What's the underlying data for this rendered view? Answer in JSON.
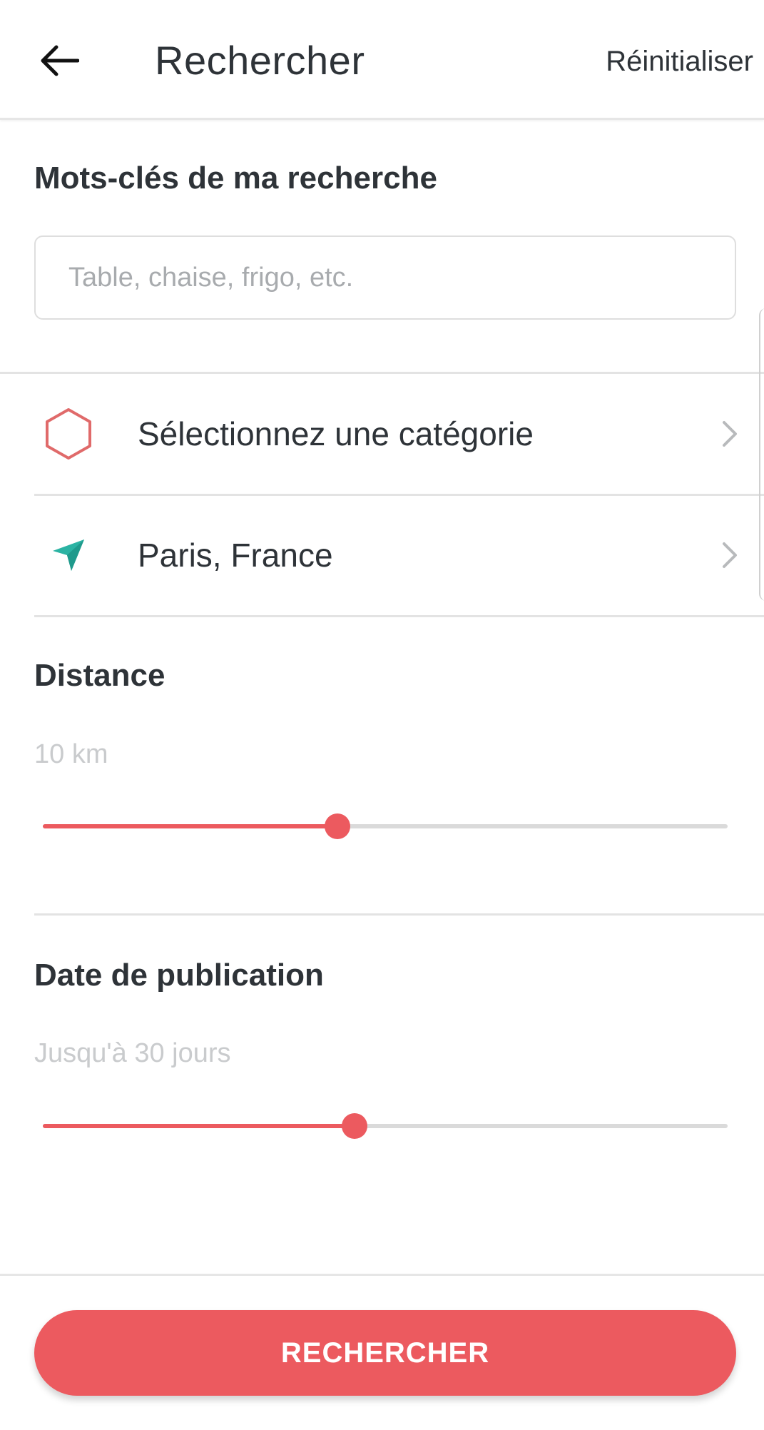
{
  "header": {
    "back_icon": "arrow-left-icon",
    "title": "Rechercher",
    "reset_label": "Réinitialiser"
  },
  "keywords": {
    "title": "Mots-clés de ma recherche",
    "input_value": "",
    "placeholder": "Table, chaise, frigo, etc."
  },
  "category": {
    "icon": "hexagon-icon",
    "label": "Sélectionnez une catégorie"
  },
  "location": {
    "icon": "navigation-arrow-icon",
    "label": "Paris, France"
  },
  "distance": {
    "title": "Distance",
    "value_label": "10 km",
    "slider_fraction": 0.43
  },
  "publication_date": {
    "title": "Date de publication",
    "value_label": "Jusqu'à 30 jours",
    "slider_fraction": 0.455
  },
  "search_button": {
    "label": "RECHERCHER"
  },
  "colors": {
    "accent": "#ec5a5f",
    "location_icon": "#2bb3a3",
    "text": "#2e3338",
    "muted": "#c9cbcd"
  }
}
